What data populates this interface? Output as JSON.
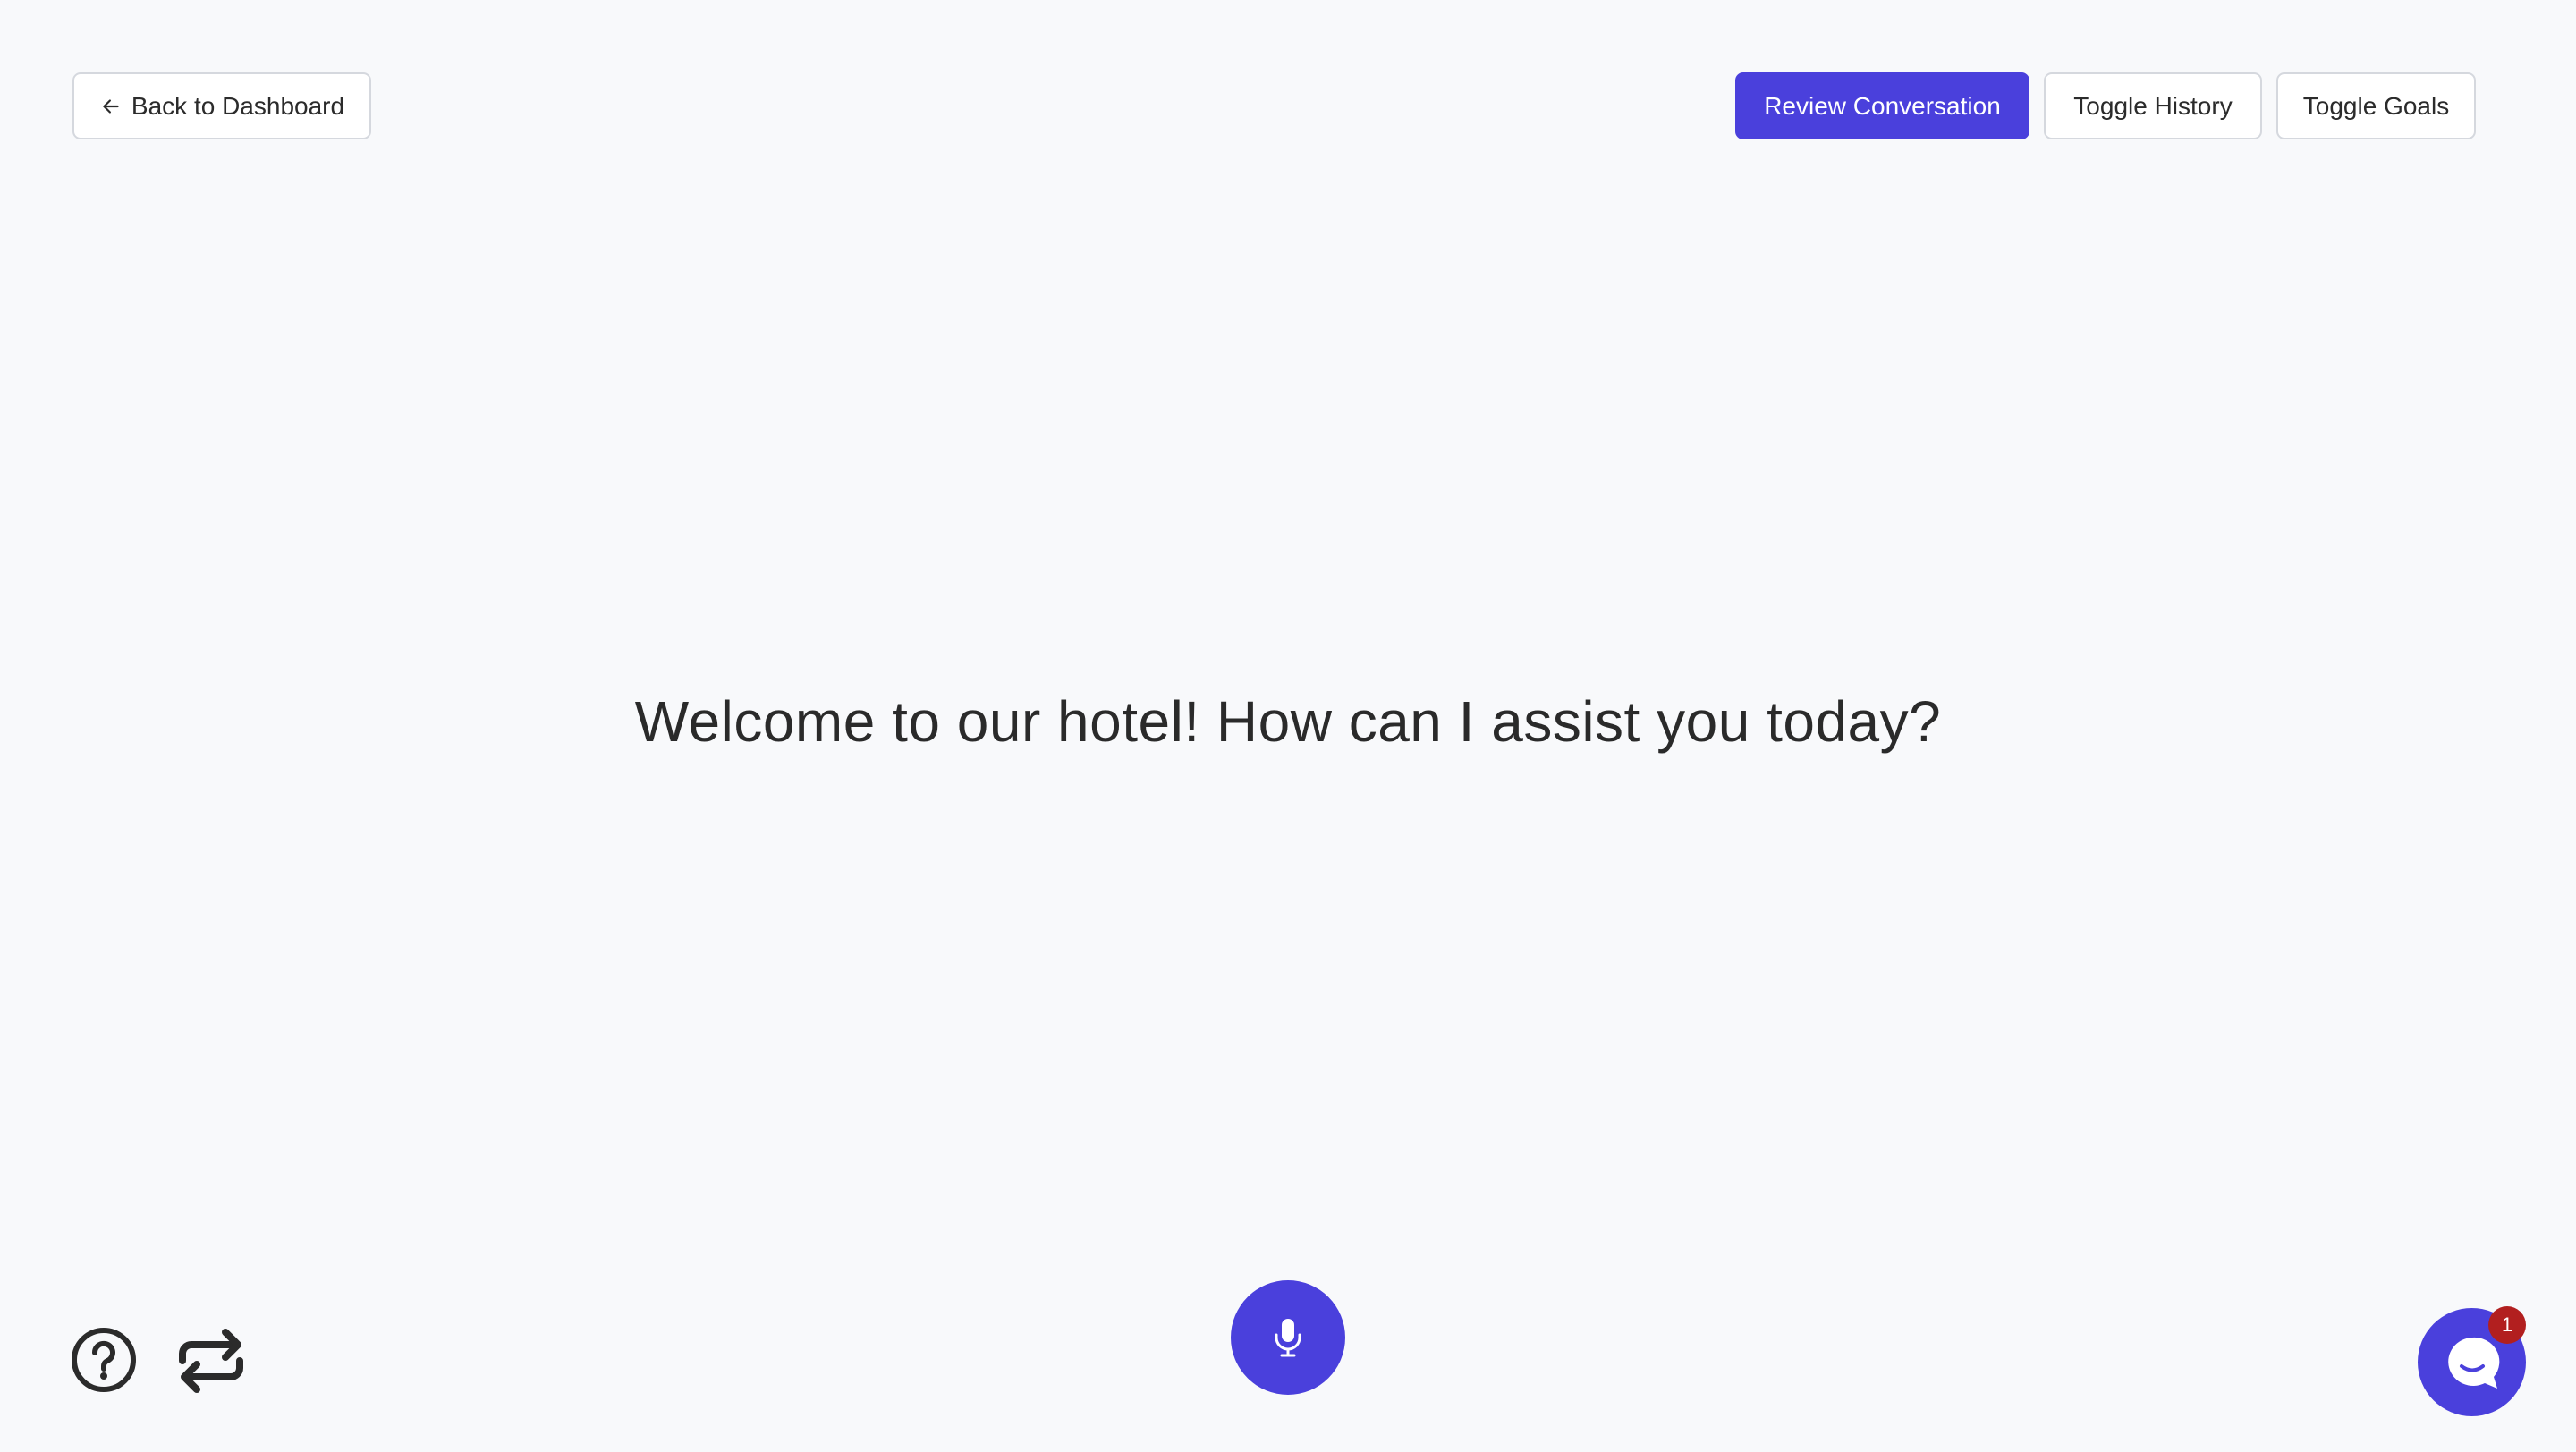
{
  "header": {
    "back_label": "Back to Dashboard",
    "review_label": "Review Conversation",
    "history_label": "Toggle History",
    "goals_label": "Toggle Goals"
  },
  "main": {
    "welcome_text": "Welcome to our hotel! How can I assist you today?"
  },
  "controls": {
    "help_icon": "question-circle-icon",
    "repeat_icon": "repeat-icon",
    "mic_icon": "microphone-icon",
    "chat_icon": "chat-bubble-icon",
    "chat_badge_count": "1"
  },
  "colors": {
    "accent": "#4a40dc",
    "badge": "#b21f1f",
    "background": "#f8f9fb"
  }
}
